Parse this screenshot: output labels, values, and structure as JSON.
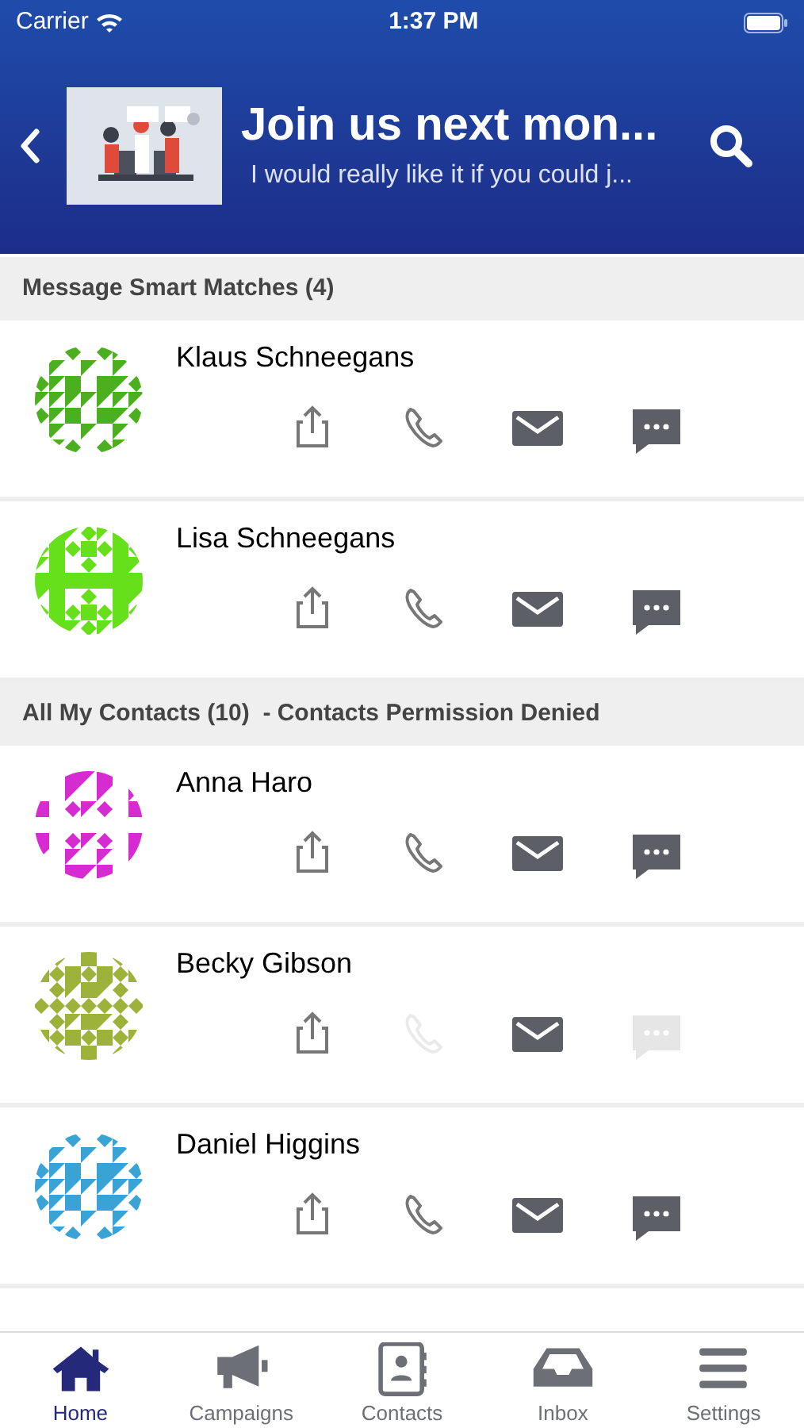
{
  "status_bar": {
    "carrier": "Carrier",
    "time": "1:37 PM"
  },
  "header": {
    "title": "Join us next mon...",
    "subtitle": "I would really like it if you could j..."
  },
  "sections": [
    {
      "title": "Message Smart Matches (4)",
      "contacts": [
        {
          "name": "Klaus Schneegans",
          "color": "#4caf1f",
          "actions": [
            {
              "kind": "share",
              "disabled": false
            },
            {
              "kind": "call",
              "disabled": false
            },
            {
              "kind": "email",
              "disabled": false
            },
            {
              "kind": "message",
              "disabled": false
            }
          ]
        },
        {
          "name": "Lisa Schneegans",
          "color": "#66e01a",
          "actions": [
            {
              "kind": "share",
              "disabled": false
            },
            {
              "kind": "call",
              "disabled": false
            },
            {
              "kind": "email",
              "disabled": false
            },
            {
              "kind": "message",
              "disabled": false
            }
          ]
        }
      ]
    },
    {
      "title": "All My Contacts (10)  - Contacts Permission Denied",
      "contacts": [
        {
          "name": "Anna Haro",
          "color": "#d62bd1",
          "actions": [
            {
              "kind": "share",
              "disabled": false
            },
            {
              "kind": "call",
              "disabled": false
            },
            {
              "kind": "email",
              "disabled": false
            },
            {
              "kind": "message",
              "disabled": false
            }
          ]
        },
        {
          "name": "Becky Gibson",
          "color": "#9db23a",
          "actions": [
            {
              "kind": "share",
              "disabled": false
            },
            {
              "kind": "call",
              "disabled": true
            },
            {
              "kind": "email",
              "disabled": false
            },
            {
              "kind": "message",
              "disabled": true
            }
          ]
        },
        {
          "name": "Daniel Higgins",
          "color": "#3aa3d6",
          "actions": [
            {
              "kind": "share",
              "disabled": false
            },
            {
              "kind": "call",
              "disabled": false
            },
            {
              "kind": "email",
              "disabled": false
            },
            {
              "kind": "message",
              "disabled": false
            }
          ]
        }
      ]
    }
  ],
  "tabs": [
    {
      "label": "Home",
      "kind": "home",
      "selected": true
    },
    {
      "label": "Campaigns",
      "kind": "megaphone",
      "selected": false
    },
    {
      "label": "Contacts",
      "kind": "contacts",
      "selected": false
    },
    {
      "label": "Inbox",
      "kind": "inbox",
      "selected": false
    },
    {
      "label": "Settings",
      "kind": "menu",
      "selected": false
    }
  ]
}
